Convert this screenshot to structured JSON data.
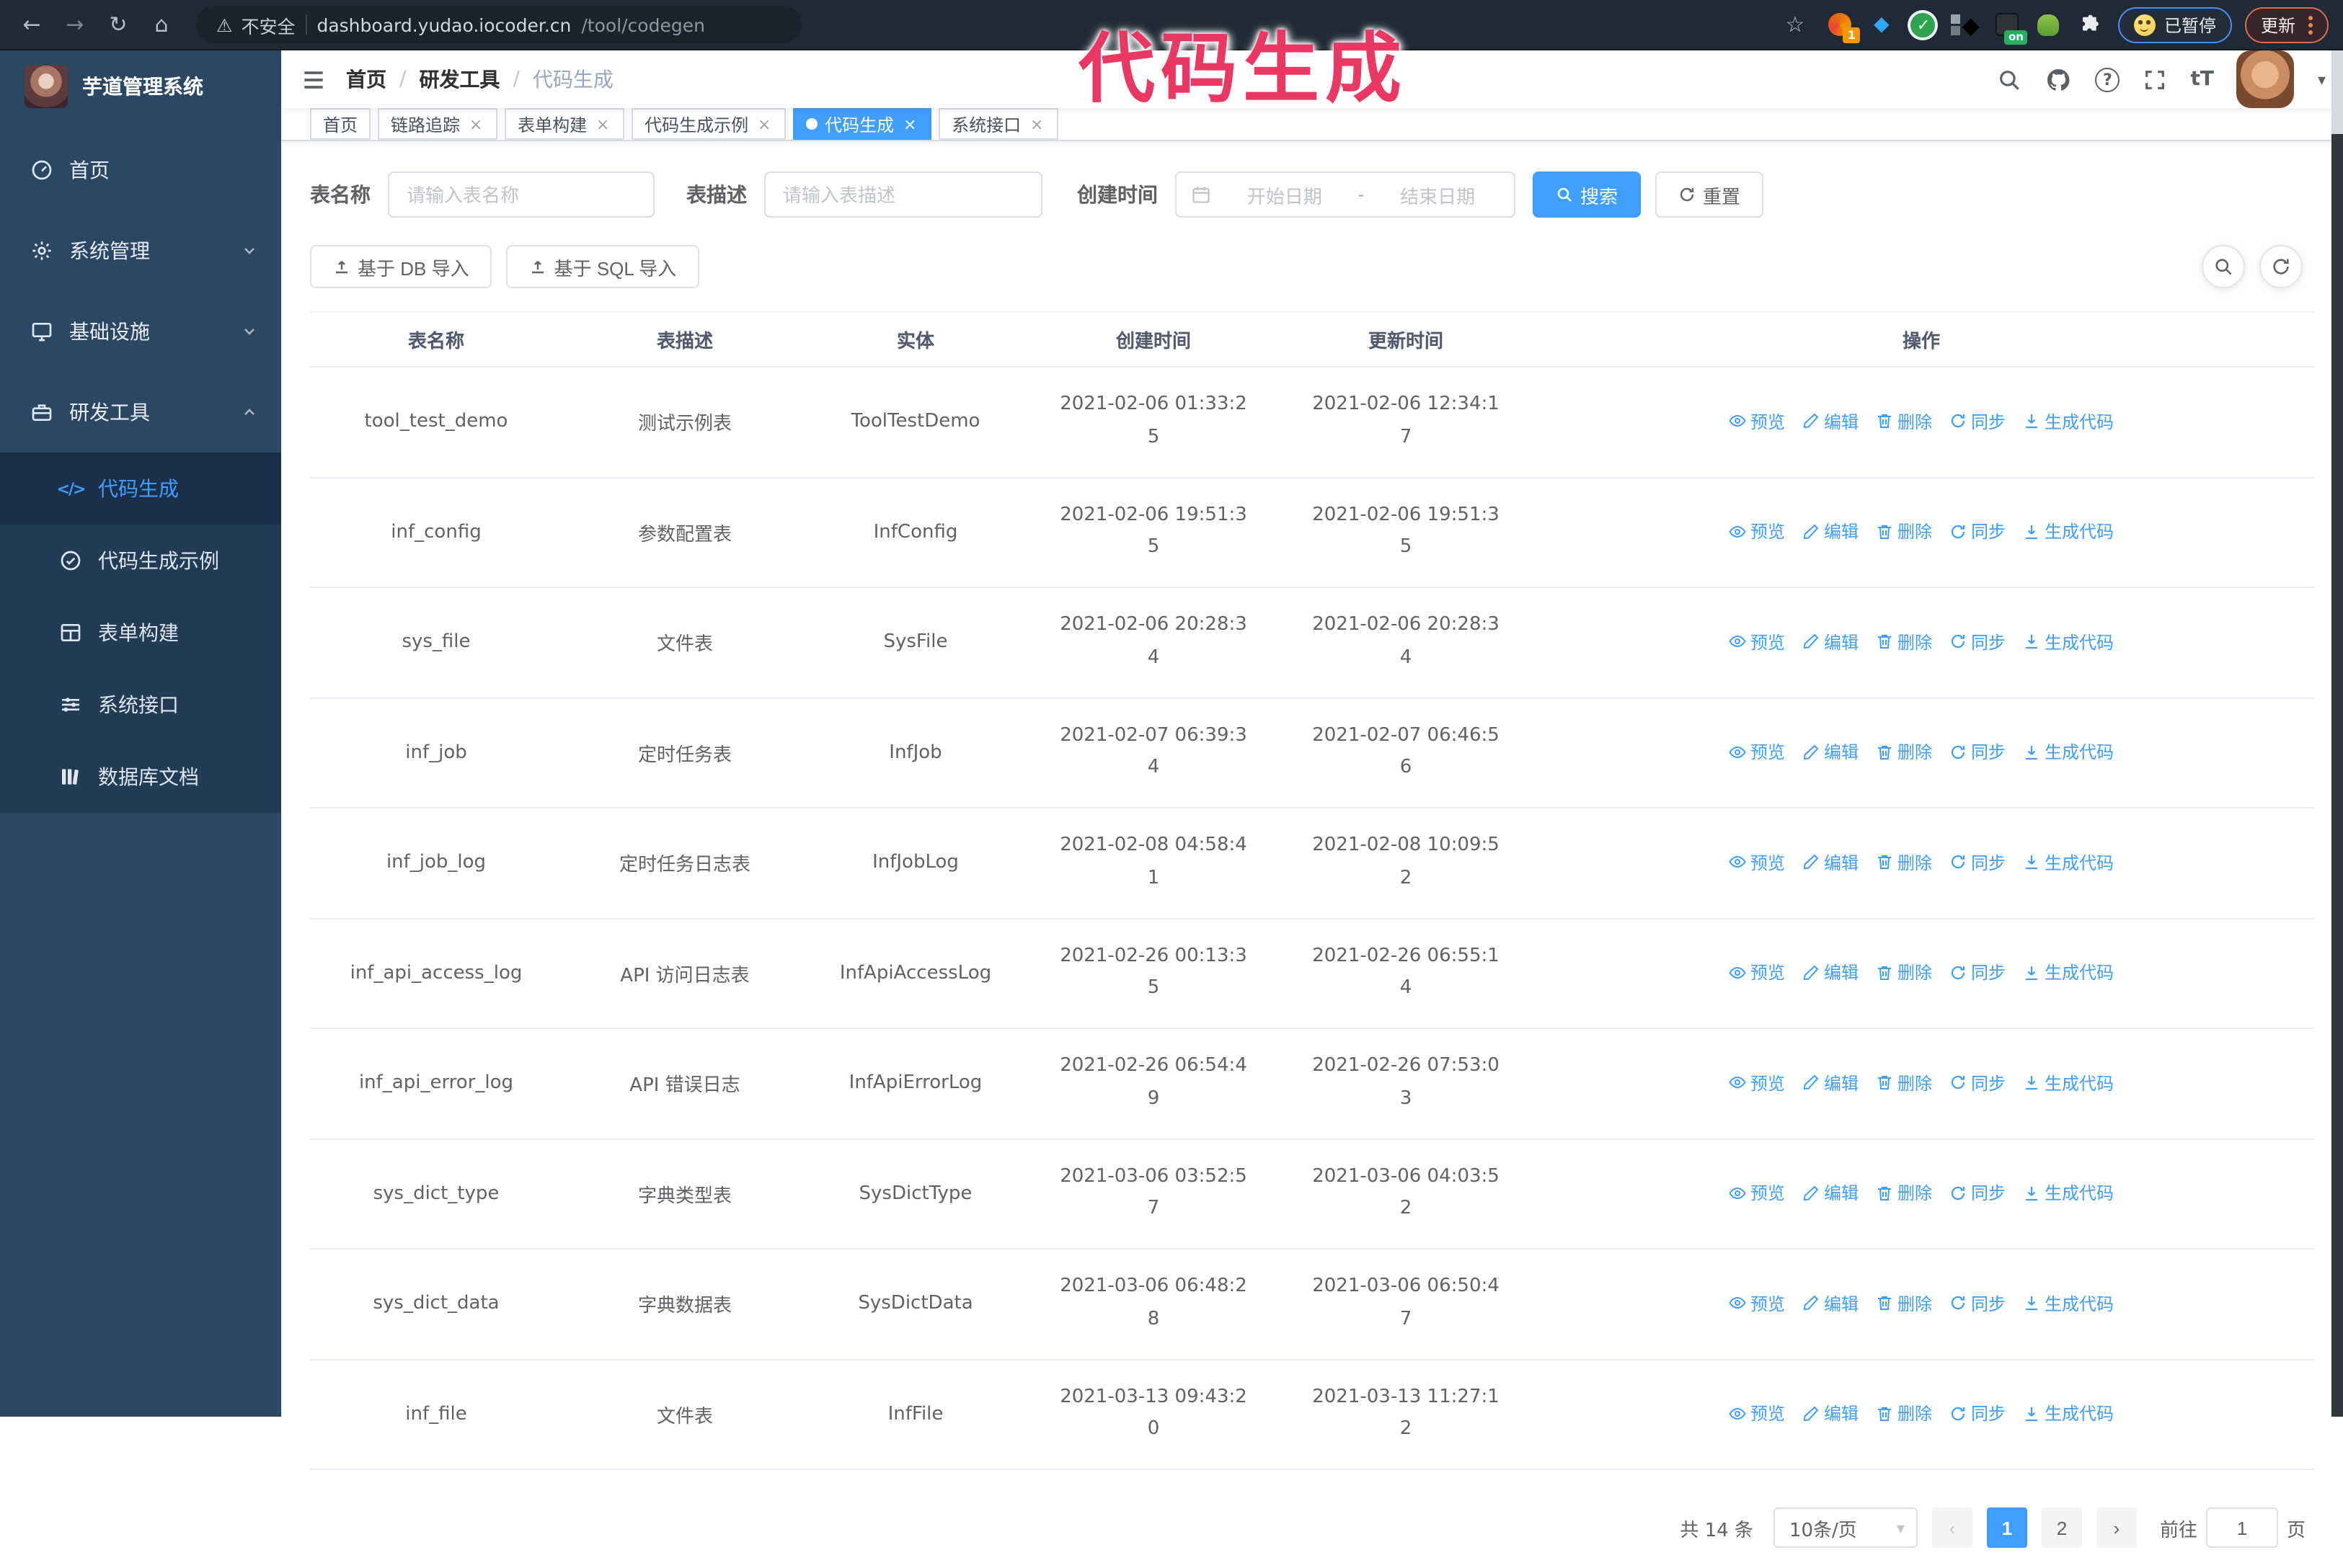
{
  "colors": {
    "accent": "#409eff",
    "annotation": "#ea3862"
  },
  "glyphs": {
    "back": "←",
    "forward": "→",
    "reload": "↻",
    "home": "⌂",
    "warning": "⚠",
    "star": "☆",
    "diamond": "◆",
    "check": "✓",
    "slash": "/",
    "close": "×",
    "question": "?",
    "text_size": "tT",
    "caret_down": "▾",
    "prev": "‹",
    "next": "›",
    "code": "</>"
  },
  "browser": {
    "security_label": "不安全",
    "url_host": "dashboard.yudao.iocoder.cn",
    "url_path": "/tool/codegen",
    "ext_badge_count": "1",
    "ext_badge_on": "on",
    "paused_label": "已暂停",
    "update_label": "更新"
  },
  "annotation": {
    "text": "代码生成"
  },
  "sidebar": {
    "title": "芋道管理系统",
    "items": [
      {
        "label": "首页"
      },
      {
        "label": "系统管理"
      },
      {
        "label": "基础设施"
      },
      {
        "label": "研发工具",
        "children": [
          {
            "label": "代码生成"
          },
          {
            "label": "代码生成示例"
          },
          {
            "label": "表单构建"
          },
          {
            "label": "系统接口"
          },
          {
            "label": "数据库文档"
          }
        ]
      }
    ]
  },
  "header": {
    "breadcrumb": [
      "首页",
      "研发工具",
      "代码生成"
    ]
  },
  "tabs": [
    {
      "label": "首页"
    },
    {
      "label": "链路追踪"
    },
    {
      "label": "表单构建"
    },
    {
      "label": "代码生成示例"
    },
    {
      "label": "代码生成"
    },
    {
      "label": "系统接口"
    }
  ],
  "filters": {
    "name_label": "表名称",
    "name_placeholder": "请输入表名称",
    "desc_label": "表描述",
    "desc_placeholder": "请输入表描述",
    "time_label": "创建时间",
    "start_placeholder": "开始日期",
    "range_separator": "-",
    "end_placeholder": "结束日期",
    "search_label": "搜索",
    "reset_label": "重置"
  },
  "toolbar": {
    "import_db_label": "基于 DB 导入",
    "import_sql_label": "基于 SQL 导入"
  },
  "table": {
    "headers": [
      "表名称",
      "表描述",
      "实体",
      "创建时间",
      "更新时间",
      "操作"
    ],
    "actions": [
      {
        "name": "preview",
        "label": "预览"
      },
      {
        "name": "edit",
        "label": "编辑"
      },
      {
        "name": "delete",
        "label": "删除"
      },
      {
        "name": "sync",
        "label": "同步"
      },
      {
        "name": "generate",
        "label": "生成代码"
      }
    ],
    "rows": [
      {
        "name": "tool_test_demo",
        "desc": "测试示例表",
        "entity": "ToolTestDemo",
        "created": "2021-02-06 01:33:25",
        "updated": "2021-02-06 12:34:17"
      },
      {
        "name": "inf_config",
        "desc": "参数配置表",
        "entity": "InfConfig",
        "created": "2021-02-06 19:51:35",
        "updated": "2021-02-06 19:51:35"
      },
      {
        "name": "sys_file",
        "desc": "文件表",
        "entity": "SysFile",
        "created": "2021-02-06 20:28:34",
        "updated": "2021-02-06 20:28:34"
      },
      {
        "name": "inf_job",
        "desc": "定时任务表",
        "entity": "InfJob",
        "created": "2021-02-07 06:39:34",
        "updated": "2021-02-07 06:46:56"
      },
      {
        "name": "inf_job_log",
        "desc": "定时任务日志表",
        "entity": "InfJobLog",
        "created": "2021-02-08 04:58:41",
        "updated": "2021-02-08 10:09:52"
      },
      {
        "name": "inf_api_access_log",
        "desc": "API 访问日志表",
        "entity": "InfApiAccessLog",
        "created": "2021-02-26 00:13:35",
        "updated": "2021-02-26 06:55:14"
      },
      {
        "name": "inf_api_error_log",
        "desc": "API 错误日志",
        "entity": "InfApiErrorLog",
        "created": "2021-02-26 06:54:49",
        "updated": "2021-02-26 07:53:03"
      },
      {
        "name": "sys_dict_type",
        "desc": "字典类型表",
        "entity": "SysDictType",
        "created": "2021-03-06 03:52:57",
        "updated": "2021-03-06 04:03:52"
      },
      {
        "name": "sys_dict_data",
        "desc": "字典数据表",
        "entity": "SysDictData",
        "created": "2021-03-06 06:48:28",
        "updated": "2021-03-06 06:50:47"
      },
      {
        "name": "inf_file",
        "desc": "文件表",
        "entity": "InfFile",
        "created": "2021-03-13 09:43:20",
        "updated": "2021-03-13 11:27:12"
      }
    ]
  },
  "pagination": {
    "total_label": "共 14 条",
    "page_size_label": "10条/页",
    "pages": [
      "1",
      "2"
    ],
    "active_page": "1",
    "goto_label": "前往",
    "goto_value": "1",
    "page_suffix": "页"
  }
}
